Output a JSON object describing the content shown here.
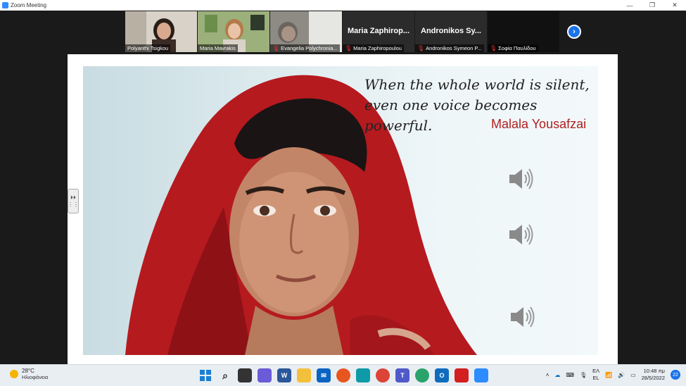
{
  "window": {
    "title": "Zoom Meeting",
    "minimize": "—",
    "restore": "❐",
    "close": "✕"
  },
  "participants": [
    {
      "name": "Polyanthi Tsigkou",
      "muted": false,
      "video": true
    },
    {
      "name": "Maria Mavrakis",
      "muted": false,
      "video": true
    },
    {
      "name": "Evangelia Polychronia...",
      "muted": true,
      "video": true
    },
    {
      "name": "Maria Zaphiropoulou",
      "display_name": "Maria Zaphirop...",
      "muted": true,
      "video": false
    },
    {
      "name": "Andronikos Symeon P...",
      "display_name": "Andronikos Sy...",
      "muted": true,
      "video": false
    },
    {
      "name": "Σοφία Παυλίδου",
      "muted": true,
      "video": false
    }
  ],
  "gallery": {
    "next_label": "›"
  },
  "slide": {
    "quote_line1": "When the whole world is silent,",
    "quote_line2": "even one voice becomes powerful.",
    "author": "Malala Yousafzai"
  },
  "side_handle": {
    "label": "⏵⏵"
  },
  "taskbar": {
    "weather_temp": "28°C",
    "weather_condition": "Ηλιοφάνεια",
    "lang_top": "ΕΛ",
    "lang_bottom": "EL",
    "time": "10:48 πμ",
    "date": "28/5/2022",
    "notification_count": "22"
  },
  "colors": {
    "accent": "#2d8cff",
    "author": "#b02020",
    "taskbar": "#e9eef3"
  }
}
